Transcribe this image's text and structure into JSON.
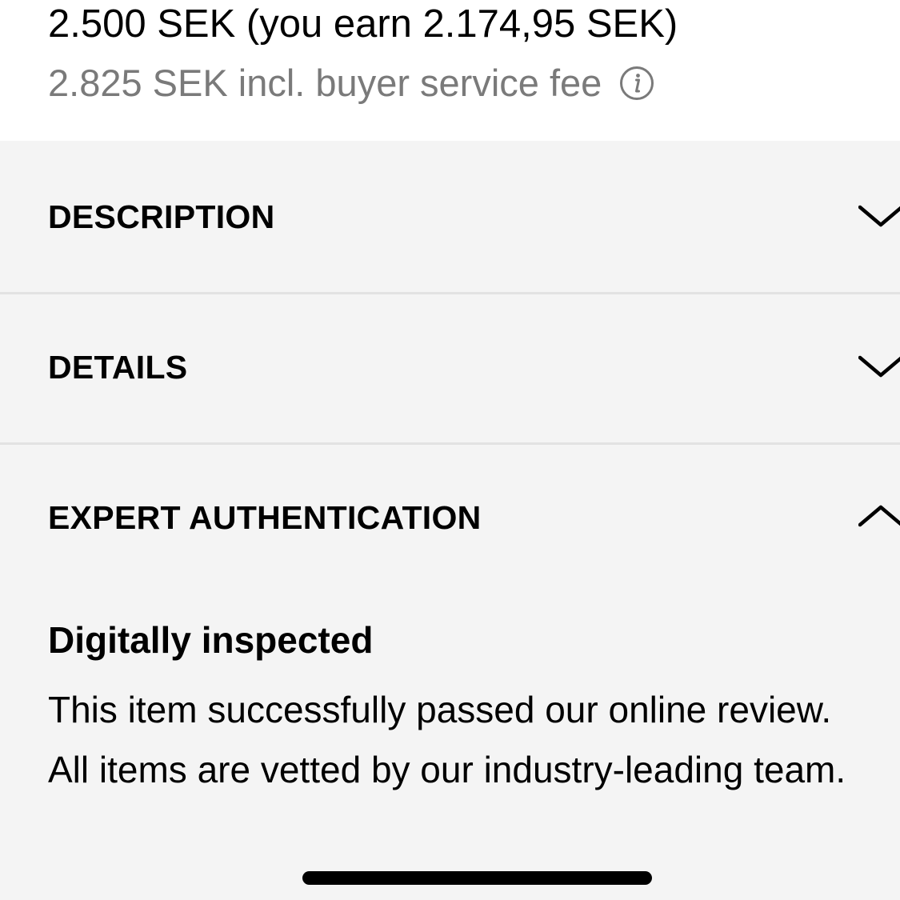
{
  "price": {
    "main": "2.500 SEK (you earn 2.174,95 SEK)",
    "with_fee": "2.825 SEK incl. buyer service fee",
    "info_icon": "info-circle-icon"
  },
  "accordion": {
    "sections": [
      {
        "title": "DESCRIPTION",
        "state": "collapsed",
        "icon": "chevron-down-icon"
      },
      {
        "title": "DETAILS",
        "state": "collapsed",
        "icon": "chevron-down-icon"
      },
      {
        "title": "EXPERT AUTHENTICATION",
        "state": "expanded",
        "icon": "chevron-up-icon"
      }
    ],
    "authentication": {
      "heading": "Digitally inspected",
      "text": "This item successfully passed our online review. All items are vetted by our industry-leading team."
    }
  },
  "colors": {
    "price_secondary": "#7a7a7a",
    "accordion_background": "#f4f4f4",
    "divider": "#e2e2e2"
  }
}
